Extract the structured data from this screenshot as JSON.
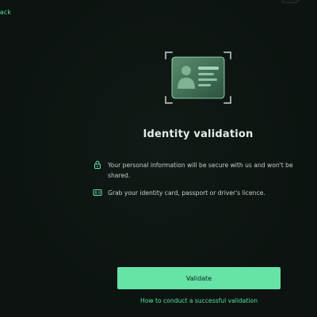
{
  "header": {
    "back_label": "Back"
  },
  "main": {
    "title": "Identity validation",
    "info": [
      {
        "icon": "lock-icon",
        "text": "Your personal information will be secure with us and won't be shared."
      },
      {
        "icon": "id-card-icon",
        "text": "Grab your identity card, passport or driver's licence."
      }
    ]
  },
  "actions": {
    "validate_label": "Validate",
    "howto_label": "How to conduct a successful validation"
  },
  "colors": {
    "background": "#0d1411",
    "accent": "#66e3a6",
    "accent_text": "#5fe0a0",
    "text_primary": "#e4ebe7",
    "text_secondary": "#c7d0cb"
  }
}
